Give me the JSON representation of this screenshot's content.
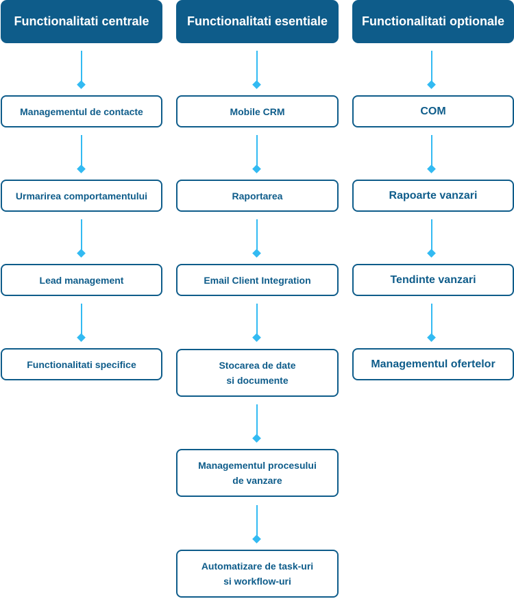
{
  "columns": [
    {
      "title": "Functionalitati centrale",
      "items": [
        "Managementul de contacte",
        "Urmarirea comportamentului",
        "Lead management",
        "Functionalitati specifice"
      ]
    },
    {
      "title": "Functionalitati esentiale",
      "items": [
        "Mobile CRM",
        "Raportarea",
        "Email Client Integration",
        "Stocarea de date\nsi documente",
        "Managementul procesului\nde vanzare",
        "Automatizare de task-uri\nsi workflow-uri"
      ]
    },
    {
      "title": "Functionalitati optionale",
      "items": [
        "COM",
        "Rapoarte vanzari",
        "Tendinte vanzari",
        "Managementul ofertelor"
      ]
    }
  ],
  "colors": {
    "header_bg": "#0e5c8a",
    "border": "#0e5c8a",
    "connector": "#32baf2"
  }
}
